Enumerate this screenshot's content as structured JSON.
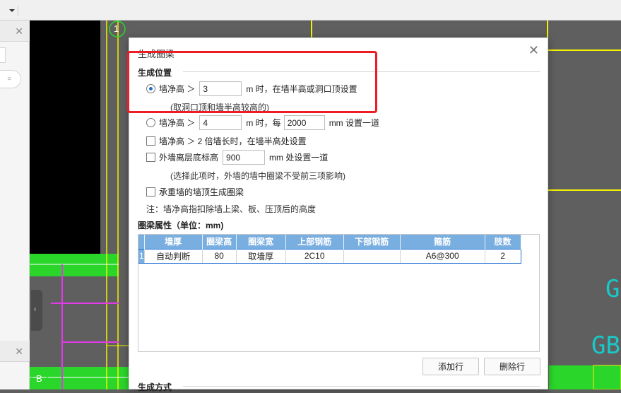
{
  "toolbar": {
    "dropdown_icon": "chevron-down-icon"
  },
  "left_panel": {
    "close_label": "✕",
    "search_icon": "search-icon"
  },
  "canvas": {
    "axis_1": "1",
    "axis_b": "B",
    "collapse_label": "‹",
    "partial_text_g": "G",
    "partial_text_gb": "GB",
    "colors": {
      "background": "#5f5f5f",
      "yellow": "#f2f200",
      "green": "#2bd62b",
      "magenta": "#e13ae8",
      "cyan": "#19c8c8"
    }
  },
  "dialog": {
    "title": "生成圈梁",
    "close": "✕",
    "section_position": "生成位置",
    "opt1": {
      "prefix": "墙净高 ＞",
      "value": "3",
      "suffix": "m 时，在墙半高或洞口顶设置",
      "note": "(取洞口顶和墙半高较高的)"
    },
    "opt2": {
      "prefix": "墙净高 ＞",
      "value": "4",
      "mid": "m 时，每",
      "value2": "2000",
      "suffix": "mm 设置一道"
    },
    "chk1": {
      "label": "墙净高 ＞ 2 倍墙长时，在墙半高处设置"
    },
    "chk2": {
      "prefix": "外墙离层底标高",
      "value": "900",
      "suffix": "mm 处设置一道",
      "note": "(选择此项时，外墙的墙中圈梁不受前三项影响)"
    },
    "chk3": {
      "label": "承重墙的墙顶生成圈梁"
    },
    "remark": "注：墙净高指扣除墙上梁、板、压顶后的高度",
    "section_props": "圈梁属性（单位：mm)",
    "table": {
      "headers": [
        "墙厚",
        "圈梁高",
        "圈梁宽",
        "上部钢筋",
        "下部钢筋",
        "箍筋",
        "肢数"
      ],
      "rows": [
        [
          "1",
          "自动判断",
          "80",
          "取墙厚",
          "2C10",
          "",
          "A6@300",
          "2"
        ]
      ]
    },
    "add_row": "添加行",
    "delete_row": "删除行",
    "section_method": "生成方式",
    "accent": "#79aee0",
    "highlight_color": "#ee1c24"
  }
}
